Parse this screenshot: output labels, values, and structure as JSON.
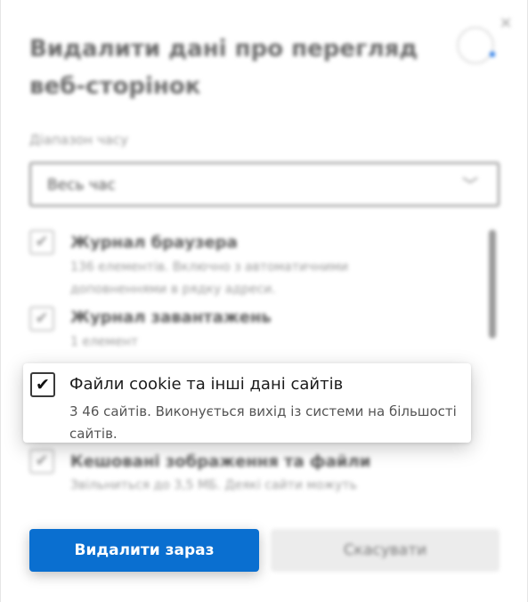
{
  "dialog": {
    "title": "Видалити дані про перегляд веб-сторінок",
    "close_glyph": "×",
    "time_range_label": "Діапазон часу",
    "time_range_value": "Весь час",
    "chevron_glyph": "﹀"
  },
  "items": [
    {
      "title": "Журнал браузера",
      "description": "136 елементів. Включно з автоматичними доповненнями в рядку адреси.",
      "checked": true
    },
    {
      "title": "Журнал завантажень",
      "description": "1 елемент",
      "checked": true
    },
    {
      "title": "Файли cookie та інші дані сайтів",
      "description": "3 46 сайтів. Виконується вихід із системи на більшості сайтів.",
      "checked": true
    },
    {
      "title": "Кешовані зображення та файли",
      "description": "Звільниться до 3,5 МБ. Деякі сайти можуть",
      "checked": true
    }
  ],
  "check_glyph": "✔",
  "buttons": {
    "delete_label": "Видалити зараз",
    "cancel_label": "Скасувати"
  },
  "colors": {
    "primary_button": "#0a6fd0",
    "accent": "#1a73e8"
  }
}
